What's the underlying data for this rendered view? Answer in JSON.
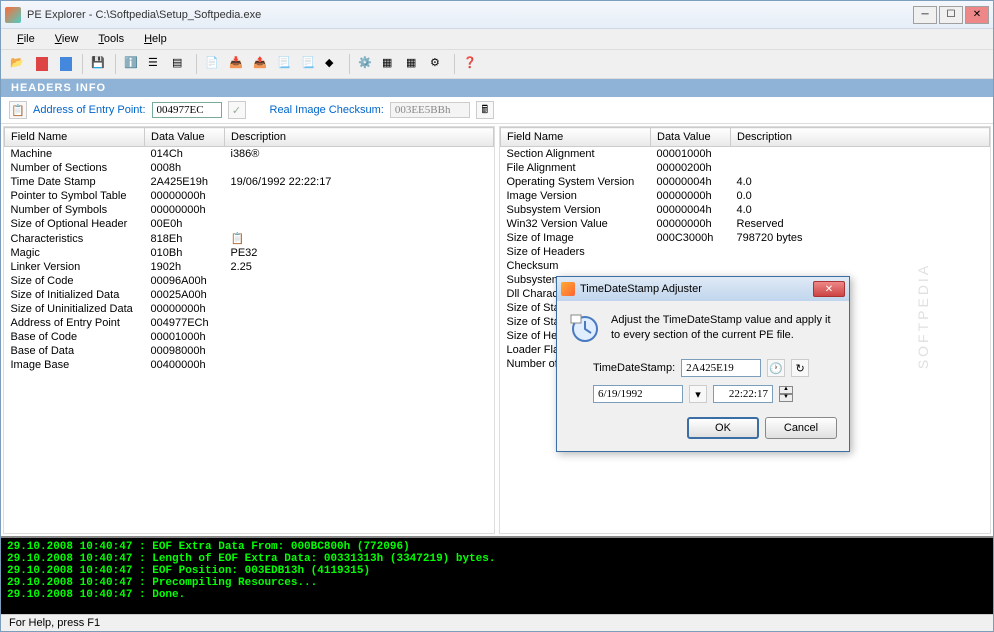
{
  "window": {
    "title": "PE Explorer - C:\\Softpedia\\Setup_Softpedia.exe"
  },
  "menu": {
    "file": "File",
    "view": "View",
    "tools": "Tools",
    "help": "Help"
  },
  "section_header": "HEADERS INFO",
  "info_bar": {
    "entry_point_label": "Address of Entry Point:",
    "entry_point_value": "004977EC",
    "checksum_label": "Real Image Checksum:",
    "checksum_value": "003EE5BBh"
  },
  "columns": {
    "field": "Field Name",
    "value": "Data Value",
    "desc": "Description"
  },
  "left_rows": [
    {
      "f": "Machine",
      "v": "014Ch",
      "d": "i386®"
    },
    {
      "f": "Number of Sections",
      "v": "0008h",
      "d": ""
    },
    {
      "f": "Time Date Stamp",
      "v": "2A425E19h",
      "d": "19/06/1992  22:22:17"
    },
    {
      "f": "Pointer to Symbol Table",
      "v": "00000000h",
      "d": ""
    },
    {
      "f": "Number of Symbols",
      "v": "00000000h",
      "d": ""
    },
    {
      "f": "Size of Optional Header",
      "v": "00E0h",
      "d": ""
    },
    {
      "f": "Characteristics",
      "v": "818Eh",
      "d": "📋"
    },
    {
      "f": "Magic",
      "v": "010Bh",
      "d": "PE32"
    },
    {
      "f": "Linker Version",
      "v": "1902h",
      "d": "2.25"
    },
    {
      "f": "Size of Code",
      "v": "00096A00h",
      "d": ""
    },
    {
      "f": "Size of Initialized Data",
      "v": "00025A00h",
      "d": ""
    },
    {
      "f": "Size of Uninitialized Data",
      "v": "00000000h",
      "d": ""
    },
    {
      "f": "Address of Entry Point",
      "v": "004977ECh",
      "d": ""
    },
    {
      "f": "Base of Code",
      "v": "00001000h",
      "d": ""
    },
    {
      "f": "Base of Data",
      "v": "00098000h",
      "d": ""
    },
    {
      "f": "Image Base",
      "v": "00400000h",
      "d": ""
    }
  ],
  "right_rows": [
    {
      "f": "Section Alignment",
      "v": "00001000h",
      "d": ""
    },
    {
      "f": "File Alignment",
      "v": "00000200h",
      "d": ""
    },
    {
      "f": "Operating System Version",
      "v": "00000004h",
      "d": "4.0"
    },
    {
      "f": "Image Version",
      "v": "00000000h",
      "d": "0.0"
    },
    {
      "f": "Subsystem Version",
      "v": "00000004h",
      "d": "4.0"
    },
    {
      "f": "Win32 Version Value",
      "v": "00000000h",
      "d": "Reserved"
    },
    {
      "f": "Size of Image",
      "v": "000C3000h",
      "d": "798720 bytes"
    },
    {
      "f": "Size of Headers",
      "v": "",
      "d": ""
    },
    {
      "f": "Checksum",
      "v": "",
      "d": ""
    },
    {
      "f": "Subsystem",
      "v": "",
      "d": ""
    },
    {
      "f": "Dll Characteristics",
      "v": "",
      "d": ""
    },
    {
      "f": "Size of Stack Reserve",
      "v": "",
      "d": ""
    },
    {
      "f": "Size of Stack Commit",
      "v": "",
      "d": ""
    },
    {
      "f": "Size of Heap Reserve",
      "v": "",
      "d": ""
    },
    {
      "f": "Loader Flags",
      "v": "",
      "d": ""
    },
    {
      "f": "Number of Data Directory",
      "v": "",
      "d": ""
    }
  ],
  "console_lines": [
    "29.10.2008 10:40:47 : EOF Extra Data From: 000BC800h  (772096)",
    "29.10.2008 10:40:47 : Length of EOF Extra Data: 00331313h  (3347219) bytes.",
    "29.10.2008 10:40:47 : EOF Position: 003EDB13h  (4119315)",
    "29.10.2008 10:40:47 : Precompiling Resources...",
    "29.10.2008 10:40:47 : Done."
  ],
  "statusbar": "For Help, press F1",
  "dialog": {
    "title": "TimeDateStamp Adjuster",
    "message": "Adjust the TimeDateStamp value and apply it to every section of the current PE file.",
    "field_label": "TimeDateStamp:",
    "field_value": "2A425E19",
    "date_value": "6/19/1992",
    "time_value": "22:22:17",
    "ok": "OK",
    "cancel": "Cancel"
  },
  "watermark": "SOFTPEDIA"
}
